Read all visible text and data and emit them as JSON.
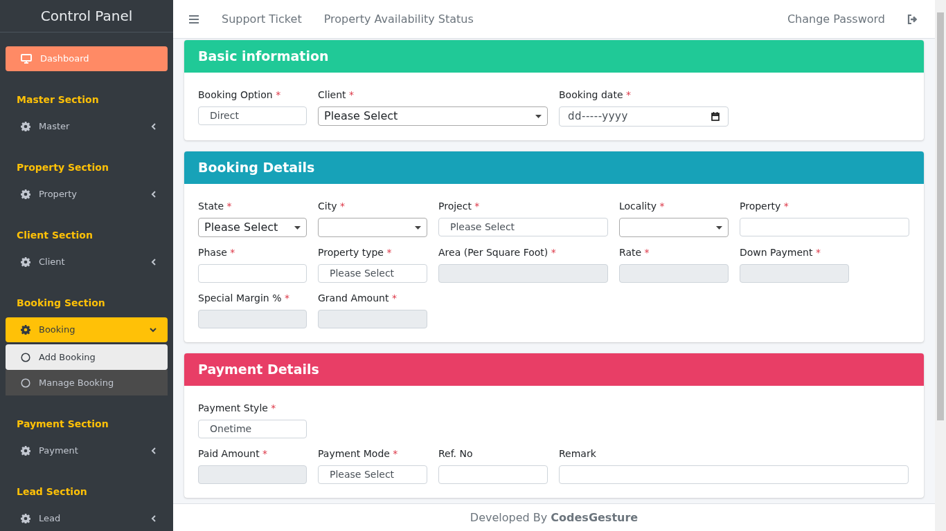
{
  "sidebar": {
    "brand": "Control Panel",
    "items": [
      {
        "kind": "link",
        "label": "Dashboard",
        "selected": true
      },
      {
        "kind": "section",
        "label": "Master Section"
      },
      {
        "kind": "menu",
        "label": "Master",
        "expanded": false
      },
      {
        "kind": "section",
        "label": "Property Section"
      },
      {
        "kind": "menu",
        "label": "Property",
        "expanded": false
      },
      {
        "kind": "section",
        "label": "Client Section"
      },
      {
        "kind": "menu",
        "label": "Client",
        "expanded": false
      },
      {
        "kind": "section",
        "label": "Booking Section"
      },
      {
        "kind": "menu",
        "label": "Booking",
        "expanded": true,
        "children": [
          {
            "label": "Add Booking",
            "selected": true
          },
          {
            "label": "Manage Booking",
            "selected": false
          }
        ]
      },
      {
        "kind": "section",
        "label": "Payment Section"
      },
      {
        "kind": "menu",
        "label": "Payment",
        "expanded": false
      },
      {
        "kind": "section",
        "label": "Lead Section"
      },
      {
        "kind": "menu",
        "label": "Lead",
        "expanded": false
      }
    ]
  },
  "navbar": {
    "links": [
      "Support Ticket",
      "Property Availability Status"
    ],
    "right_link": "Change Password"
  },
  "sections": [
    {
      "title": "Basic information",
      "color": "#20c997",
      "rows": [
        [
          {
            "label": "Booking Option",
            "required_mark": "*",
            "kind": "select",
            "value": "Direct"
          },
          {
            "label": "Client",
            "required_mark": "*",
            "kind": "dropdown",
            "value": "Please Select"
          },
          {
            "label": "Booking date",
            "required_mark": "*",
            "kind": "date",
            "value": "dd-----yyyy"
          }
        ]
      ]
    },
    {
      "title": "Booking Details",
      "color": "#17a2b8",
      "rows": [
        [
          {
            "label": "State",
            "required_mark": "*",
            "kind": "dropdown",
            "value": "Please Select"
          },
          {
            "label": "City",
            "required_mark": "*",
            "kind": "dropdown"
          },
          {
            "label": "Project",
            "required_mark": "*",
            "kind": "select",
            "value": "Please Select"
          },
          {
            "label": "Locality",
            "required_mark": "*",
            "kind": "dropdown"
          },
          {
            "label": "Property",
            "required_mark": "*",
            "kind": "select"
          }
        ],
        [
          {
            "label": "Phase",
            "required_mark": "*",
            "kind": "select"
          },
          {
            "label": "Property type",
            "required_mark": "*",
            "kind": "select",
            "value": "Please Select"
          },
          {
            "label": "Area (Per Square Foot)",
            "required_mark": "*",
            "kind": "readonly"
          },
          {
            "label": "Rate",
            "required_mark": "*",
            "kind": "readonly"
          },
          {
            "label": "Down Payment",
            "required_mark": "*",
            "kind": "readonly"
          }
        ],
        [
          {
            "label": "Special Margin %",
            "required_mark": "*",
            "kind": "readonly"
          },
          {
            "label": "Grand Amount",
            "required_mark": "*",
            "kind": "readonly"
          }
        ]
      ]
    },
    {
      "title": "Payment Details",
      "color": "#e83e66",
      "rows": [
        [
          {
            "label": "Payment Style",
            "required_mark": "*",
            "kind": "select",
            "value": "Onetime"
          }
        ],
        [
          {
            "label": "Paid Amount",
            "required_mark": "*",
            "kind": "readonly"
          },
          {
            "label": "Payment Mode",
            "required_mark": "*",
            "kind": "select",
            "value": "Please Select"
          },
          {
            "label": "Ref. No",
            "kind": "text"
          },
          {
            "label": "Remark",
            "kind": "text"
          }
        ]
      ]
    }
  ],
  "footer": "Developed By **CodesGesture**"
}
